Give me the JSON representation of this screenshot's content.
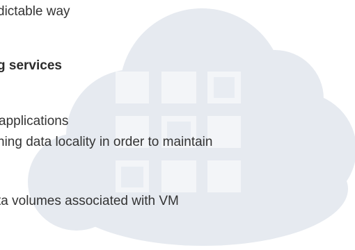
{
  "slide": {
    "lines": [
      "dictable way",
      "g services",
      "applications",
      "ning data locality in order to maintain",
      "ta volumes associated with VM"
    ]
  },
  "colors": {
    "background": "#ffffff",
    "cloud": "#e6eaf0",
    "grid_squares": "#f3f5f8",
    "text": "#333333"
  },
  "icons": [
    "cloud-icon"
  ]
}
